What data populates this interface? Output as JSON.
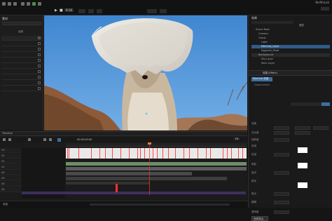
{
  "app": {
    "title": "NleMoLab",
    "brand_badge": "NleMoLab"
  },
  "topbar": {
    "menu_icons": [
      "file-icon",
      "edit-icon",
      "view-icon",
      "clip-icon",
      "track-icon",
      "settings-icon",
      "help-icon"
    ],
    "playback": {
      "play_label": "▶",
      "stop_label": "■",
      "mode_label": "9:16"
    },
    "tabs": [
      "",
      "",
      "",
      "",
      ""
    ]
  },
  "left_panel": {
    "header": "素材",
    "subheader": "全部",
    "rows": [
      "",
      "",
      "",
      "",
      "",
      "",
      "",
      "",
      "",
      ""
    ],
    "colors": {
      "accent": "#8b2d2d"
    }
  },
  "viewport": {
    "scene": "meerkat wearing eggshell helmet on blue sky background",
    "colors": {
      "sky": "#4b8fd4",
      "eggshell": "#e8e4dc",
      "rock": "#8d5a3a"
    }
  },
  "right_panel": {
    "header": "效果",
    "tab": "图层",
    "tree_items": [
      "Scene Root",
      "Camera",
      "Group",
      "Light",
      "Meerkat_Layer",
      "Eggshell_Mask",
      "Background",
      "Sky Layer",
      "Rock Layer"
    ],
    "section_title": "效果 (Effect)",
    "effect_name": "Meerkat 效果",
    "effect_sub": "ColorCorrect",
    "properties": [
      "亮度",
      "对比度",
      "饱和度",
      "色相",
      "色温",
      "阴影",
      "高光",
      "锐化",
      "噪点",
      "模糊",
      "透明度"
    ],
    "colors": {
      "selection": "#2f5c8a",
      "highlight": "#3d6ea3"
    }
  },
  "timeline": {
    "header": "Timeline",
    "timecode": "00:00:00:00",
    "zoom_label": "Fit",
    "tracks": [
      "V3",
      "V2",
      "V1",
      "A1",
      "A2",
      "A3",
      "A4",
      "A5"
    ],
    "keyframe_color": "#ff4b4b",
    "playhead_color": "#ff3030"
  },
  "bottom_bar": {
    "status": "就绪",
    "right_label": "完成导出"
  }
}
